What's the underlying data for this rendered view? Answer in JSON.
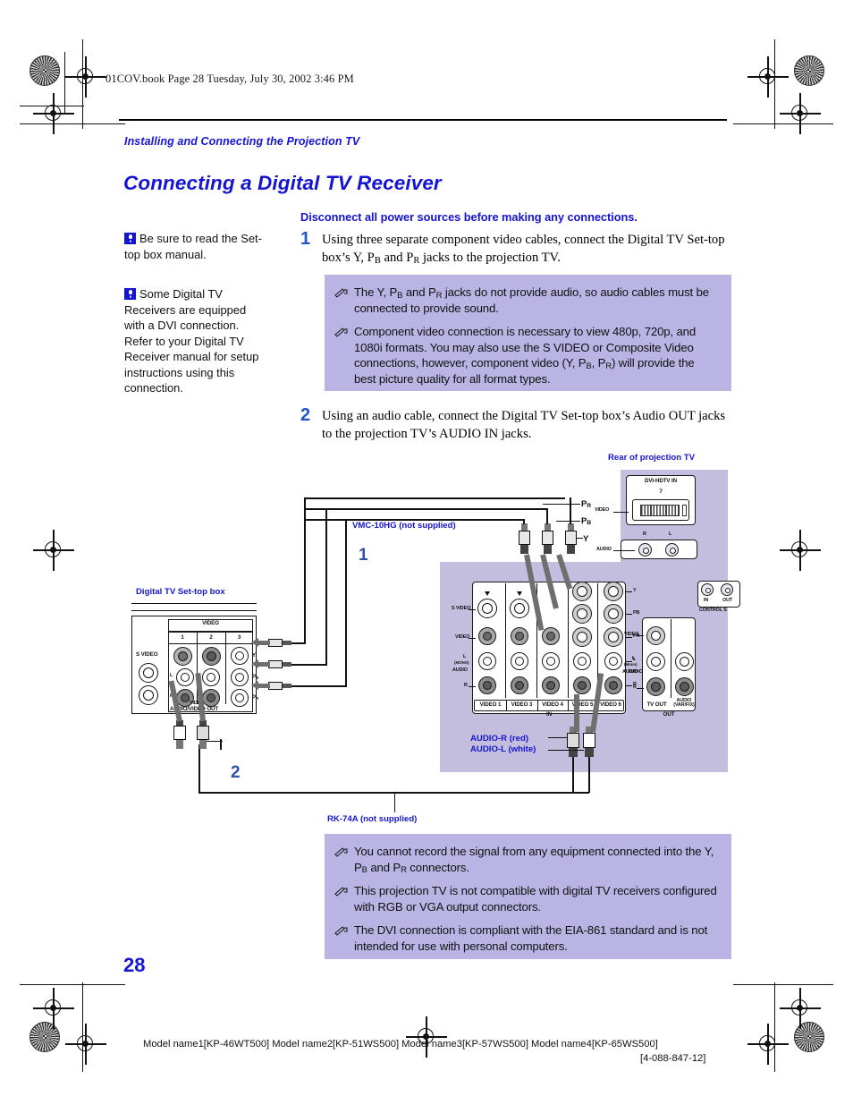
{
  "page": {
    "file_header": "01COV.book  Page 28  Tuesday, July 30, 2002  3:46 PM",
    "number": "28"
  },
  "header": {
    "kicker": "Installing and Connecting the Projection TV",
    "title": "Connecting a Digital TV Receiver"
  },
  "warning": "Disconnect all power sources before making any connections.",
  "tips": [
    {
      "icon": "lightbulb-tip-icon",
      "text": "Be sure to read the Set-top box manual."
    },
    {
      "icon": "lightbulb-tip-icon",
      "text": "Some Digital TV Receivers are equipped with a DVI connection. Refer to your Digital TV Receiver manual for setup instructions using this connection."
    }
  ],
  "steps": [
    {
      "num": "1",
      "text_parts": [
        "Using three separate component video cables, connect the Digital TV Set-top box’s Y, P",
        "B",
        " and P",
        "R",
        " jacks to the projection TV."
      ]
    },
    {
      "num": "2",
      "text_parts": [
        "Using an audio cable, connect the Digital TV Set-top box’s Audio OUT jacks to the projection TV’s AUDIO IN jacks."
      ]
    }
  ],
  "notes_top": [
    {
      "icon": "note-pencil-icon",
      "lead": "The Y, P",
      "sub1": "B",
      "mid": " and P",
      "sub2": "R",
      "tail": " jacks do not provide audio, so audio cables must be connected to provide sound."
    },
    {
      "icon": "note-pencil-icon",
      "lead": "Component video connection is necessary to view 480p, 720p, and 1080i formats. You may also use the S VIDEO or Composite Video connections, however, component video (Y, P",
      "sub1": "B",
      "mid": ", P",
      "sub2": "R",
      "tail": ") will provide the best picture quality for all format types."
    }
  ],
  "notes_bottom": [
    {
      "icon": "note-pencil-icon",
      "lead": "You cannot record the signal from any equipment connected into the Y, P",
      "sub1": "B",
      "mid": " and P",
      "sub2": "R",
      "tail": " connectors."
    },
    {
      "icon": "note-pencil-icon",
      "lead": "This projection TV is not compatible with digital TV receivers configured with RGB or VGA output connectors.",
      "sub1": "",
      "mid": "",
      "sub2": "",
      "tail": ""
    },
    {
      "icon": "note-pencil-icon",
      "lead": "The DVI connection is compliant with the EIA-861 standard and is not intended for use with personal computers.",
      "sub1": "",
      "mid": "",
      "sub2": "",
      "tail": ""
    }
  ],
  "diagram": {
    "label_rear_tv": "Rear of projection TV",
    "label_stb": "Digital TV Set-top box",
    "label_vmc": "VMC-10HG (not supplied)",
    "label_rk": "RK-74A (not supplied)",
    "label_audio_r": "AUDIO-R (red)",
    "label_audio_l": "AUDIO-L (white)",
    "step_marker_1": "1",
    "step_marker_2": "2",
    "component_labels": {
      "pr": "P",
      "pr_sub": "R",
      "pb": "P",
      "pb_sub": "B",
      "y": "Y"
    },
    "dvi": {
      "title": "DVI-HDTV IN",
      "number": "7",
      "video": "VIDEO",
      "audio": "AUDIO",
      "r": "R",
      "l": "L"
    },
    "control_s": {
      "title": "CONTROL S",
      "in": "IN",
      "out": "OUT"
    },
    "stb": {
      "video_header": "VIDEO",
      "columns": [
        "1",
        "2",
        "3"
      ],
      "svideo": "S VIDEO",
      "rows": {
        "l": "L",
        "r": "R",
        "video": "VIDEO"
      },
      "footer": "AUDIO/VIDEO OUT",
      "out_labels": [
        "Y",
        "PB",
        "PR"
      ]
    },
    "tv_panel": {
      "row_labels": [
        "S VIDEO",
        "VIDEO",
        "L",
        "(MONO)",
        "AUDIO",
        "R"
      ],
      "columns": [
        "VIDEO 1",
        "VIDEO 3",
        "VIDEO 4",
        "VIDEO 5",
        "VIDEO 6"
      ],
      "in_label": "IN",
      "right_rows": [
        "Y",
        "PB",
        "PR",
        "L",
        "AUDIO",
        "R"
      ],
      "out_columns": [
        "TV OUT",
        "AUDIO (VAR/FIX)"
      ],
      "out_label": "OUT",
      "out_rows": [
        "VIDEO",
        "L",
        "(Mono)",
        "AUDIO",
        "R"
      ]
    }
  },
  "footer": {
    "models": "Model name1[KP-46WT500] Model name2[KP-51WS500] Model name3[KP-57WS500] Model name4[KP-65WS500]",
    "doc_number": "[4-088-847-12]"
  },
  "colors": {
    "accent_blue": "#1414d2",
    "note_bg": "#b9b4e4",
    "panel_bg": "#c3bede",
    "step_blue": "#2255c4"
  }
}
